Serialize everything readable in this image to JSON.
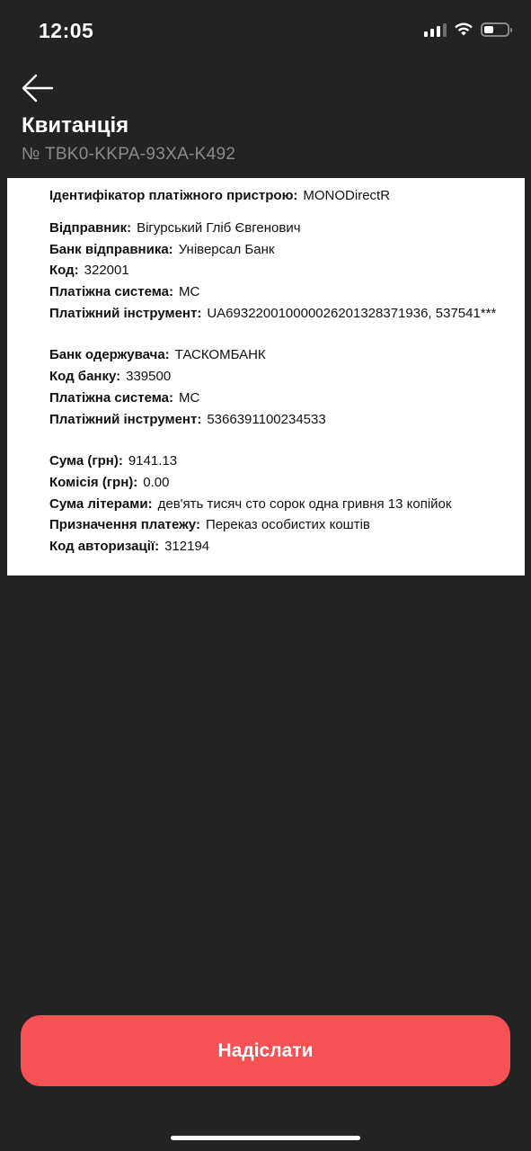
{
  "status_bar": {
    "time": "12:05",
    "icons": [
      "signal-icon",
      "wifi-icon",
      "battery-icon"
    ]
  },
  "header": {
    "back_icon": "arrow-left-icon",
    "title": "Квитанція",
    "receipt_number": "№ TBK0-KKPA-93XA-K492"
  },
  "receipt": {
    "device": {
      "label": "Ідентифікатор платіжного пристрою:",
      "value": "MONODirectR"
    },
    "sender": {
      "name": {
        "label": "Відправник:",
        "value": "Вігурський Гліб Євгенович"
      },
      "bank": {
        "label": "Банк відправника:",
        "value": "Універсал Банк"
      },
      "code": {
        "label": "Код:",
        "value": "322001"
      },
      "system": {
        "label": "Платіжна система:",
        "value": "MC"
      },
      "instrument": {
        "label": "Платіжний інструмент:",
        "value": "UA693220010000026201328371936, 537541***"
      }
    },
    "recipient": {
      "bank": {
        "label": "Банк одержувача:",
        "value": "ТАСКОМБАНК"
      },
      "code": {
        "label": "Код банку:",
        "value": "339500"
      },
      "system": {
        "label": "Платіжна система:",
        "value": "MC"
      },
      "instrument": {
        "label": "Платіжний інструмент:",
        "value": "5366391100234533"
      }
    },
    "amounts": {
      "sum": {
        "label": "Сума (грн):",
        "value": "9141.13"
      },
      "fee": {
        "label": "Комісія (грн):",
        "value": "0.00"
      },
      "words": {
        "label": "Сума літерами:",
        "value": "дев'ять тисяч сто сорок одна гривня 13 копійок"
      },
      "purpose": {
        "label": "Призначення платежу:",
        "value": "Переказ особистих коштів"
      },
      "auth": {
        "label": "Код авторизації:",
        "value": "312194"
      }
    }
  },
  "footer": {
    "send_label": "Надіслати"
  },
  "colors": {
    "background": "#232323",
    "accent": "#f65153",
    "muted_text": "#8b8b8b"
  }
}
